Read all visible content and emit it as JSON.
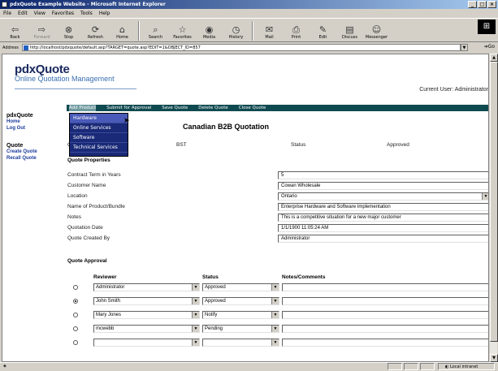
{
  "window": {
    "title": "pdxQuote Example Website - Microsoft Internet Explorer"
  },
  "menu": [
    "File",
    "Edit",
    "View",
    "Favorites",
    "Tools",
    "Help"
  ],
  "toolbar": [
    {
      "label": "Back",
      "icon": "back-arrow-icon",
      "glyph": "⇦"
    },
    {
      "label": "Forward",
      "icon": "forward-arrow-icon",
      "glyph": "⇨"
    },
    {
      "label": "Stop",
      "icon": "stop-icon",
      "glyph": "⊗"
    },
    {
      "label": "Refresh",
      "icon": "refresh-icon",
      "glyph": "⟳"
    },
    {
      "label": "Home",
      "icon": "home-icon",
      "glyph": "⌂"
    },
    {
      "label": "Search",
      "icon": "search-icon",
      "glyph": "⌕"
    },
    {
      "label": "Favorites",
      "icon": "favorites-icon",
      "glyph": "☆"
    },
    {
      "label": "Media",
      "icon": "media-icon",
      "glyph": "◉"
    },
    {
      "label": "History",
      "icon": "history-icon",
      "glyph": "◷"
    },
    {
      "label": "Mail",
      "icon": "mail-icon",
      "glyph": "✉"
    },
    {
      "label": "Print",
      "icon": "print-icon",
      "glyph": "⎙"
    },
    {
      "label": "Edit",
      "icon": "edit-icon",
      "glyph": "✎"
    },
    {
      "label": "Discuss",
      "icon": "discuss-icon",
      "glyph": "▤"
    },
    {
      "label": "Messenger",
      "icon": "messenger-icon",
      "glyph": "☺"
    }
  ],
  "address": {
    "label": "Address",
    "url": "http://localhost/pdxquote/default.asp?TARGET=quote.asp?EDIT=1&OBJECT_ID=857",
    "go": "Go"
  },
  "app": {
    "brand": "pdxQuote",
    "tagline": "Online Quotation Management",
    "current_user_label": "Current User:",
    "current_user": "Administrator"
  },
  "sidebar": {
    "section1": "pdxQuote",
    "home": "Home",
    "logout": "Log Out",
    "section2": "Quote",
    "create": "Create Quote",
    "recall": "Recall Quote"
  },
  "nav": [
    "Add Product",
    "Submit for Approval",
    "Save Quote",
    "Delete Quote",
    "Close Quote"
  ],
  "add_product_menu": [
    "Hardware",
    "Online Services",
    "Software",
    "Technical Services"
  ],
  "quote": {
    "title": "Canadian B2B Quotation",
    "col_left_first_char": "C",
    "mid_label": "BST",
    "status_label": "Status",
    "status_value": "Approved"
  },
  "properties": {
    "heading": "Quote Properties",
    "fields": [
      {
        "label": "Contract Term in Years",
        "value": "5"
      },
      {
        "label": "Customer Name",
        "value": "Cowan Wholesale"
      },
      {
        "label": "Location",
        "value": "Ontario"
      },
      {
        "label": "Name of Product/Bundle",
        "value": "Enterprise Hardware and Software Implementation"
      },
      {
        "label": "Notes",
        "value": "This is a competitive situation for a new major customer"
      },
      {
        "label": "Quotation Date",
        "value": "1/1/1900 11:05:24 AM"
      },
      {
        "label": "Quote Created By",
        "value": "Administrator"
      }
    ]
  },
  "approval": {
    "heading": "Quote Approval",
    "col_reviewer": "Reviewer",
    "col_status": "Status",
    "col_notes": "Notes/Comments",
    "rows": [
      {
        "reviewer": "Administrator",
        "status": "Approved",
        "notes": "",
        "selected": false
      },
      {
        "reviewer": "John Smith",
        "status": "Approved",
        "notes": "",
        "selected": true
      },
      {
        "reviewer": "Mary Jones",
        "status": "Notify",
        "notes": "",
        "selected": false
      },
      {
        "reviewer": "mcwebb",
        "status": "Pending",
        "notes": "",
        "selected": false
      },
      {
        "reviewer": "",
        "status": "",
        "notes": "",
        "selected": false
      }
    ]
  },
  "status": {
    "zone": "Local intranet"
  }
}
